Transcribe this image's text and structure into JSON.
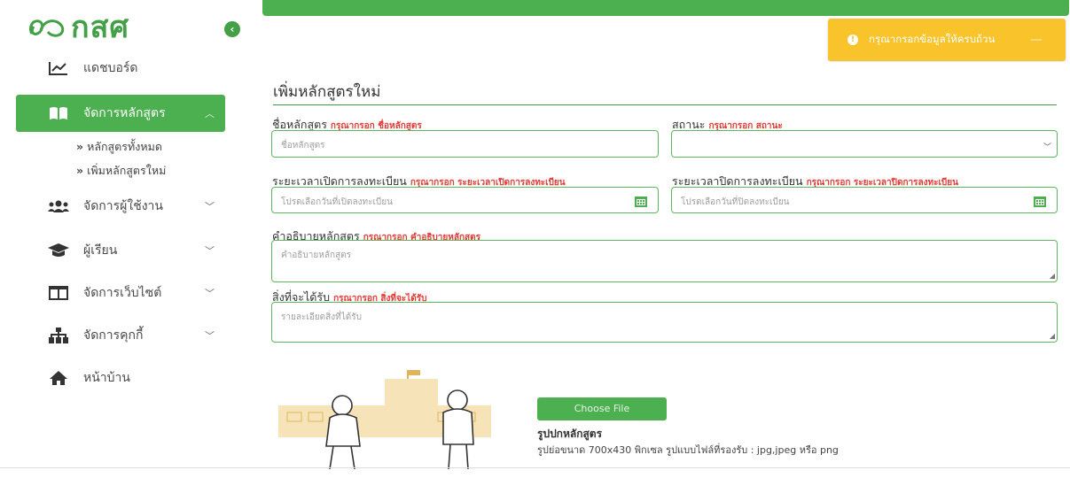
{
  "brand": {
    "logo_text": "กสศ",
    "accent": "#4caf50",
    "warning": "#f9c32b"
  },
  "toast": {
    "message": "กรุณากรอกข้อมูลให้ครบถ้วน"
  },
  "sidebar": {
    "items": [
      {
        "label": "แดชบอร์ด",
        "icon": "chart-line-icon"
      },
      {
        "label": "จัดการหลักสูตร",
        "icon": "book-icon"
      },
      {
        "label": "จัดการผู้ใช้งาน",
        "icon": "users-icon"
      },
      {
        "label": "ผู้เรียน",
        "icon": "graduation-cap-icon"
      },
      {
        "label": "จัดการเว็บไซต์",
        "icon": "columns-icon"
      },
      {
        "label": "จัดการคุกกี้",
        "icon": "sitemap-icon"
      },
      {
        "label": "หน้าบ้าน",
        "icon": "home-icon"
      }
    ],
    "sub_items": [
      {
        "label": "หลักสูตรทั้งหมด"
      },
      {
        "label": "เพิ่มหลักสูตรใหม่"
      }
    ]
  },
  "form": {
    "title": "เพิ่มหลักสูตรใหม่",
    "course_name": {
      "label": "ชื่อหลักสูตร",
      "error": "กรุณากรอก ชื่อหลักสูตร",
      "placeholder": "ชื่อหลักสูตร"
    },
    "status": {
      "label": "สถานะ",
      "error": "กรุณากรอก สถานะ",
      "value": ""
    },
    "reg_open": {
      "label": "ระยะเวลาเปิดการลงทะเบียน",
      "error": "กรุณากรอก ระยะเวลาเปิดการลงทะเบียน",
      "placeholder": "โปรดเลือกวันที่เปิดลงทะเบียน"
    },
    "reg_close": {
      "label": "ระยะเวลาปิดการลงทะเบียน",
      "error": "กรุณากรอก ระยะเวลาปิดการลงทะเบียน",
      "placeholder": "โปรดเลือกวันที่ปิดลงทะเบียน"
    },
    "description": {
      "label": "คำอธิบายหลักสูตร",
      "error": "กรุณากรอก คำอธิบายหลักสูตร",
      "placeholder": "คำอธิบายหลักสูตร"
    },
    "benefits": {
      "label": "สิ่งที่จะได้รับ",
      "error": "กรุณากรอก สิ่งที่จะได้รับ",
      "placeholder": "รายละเอียดสิ่งที่ได้รับ"
    },
    "cover": {
      "button": "Choose File",
      "title": "รูปปกหลักสูตร",
      "hint": "รูปย่อขนาด 700x430 พิกเซล รูปแบบไฟล์ที่รองรับ : jpg,jpeg หรือ png"
    }
  }
}
